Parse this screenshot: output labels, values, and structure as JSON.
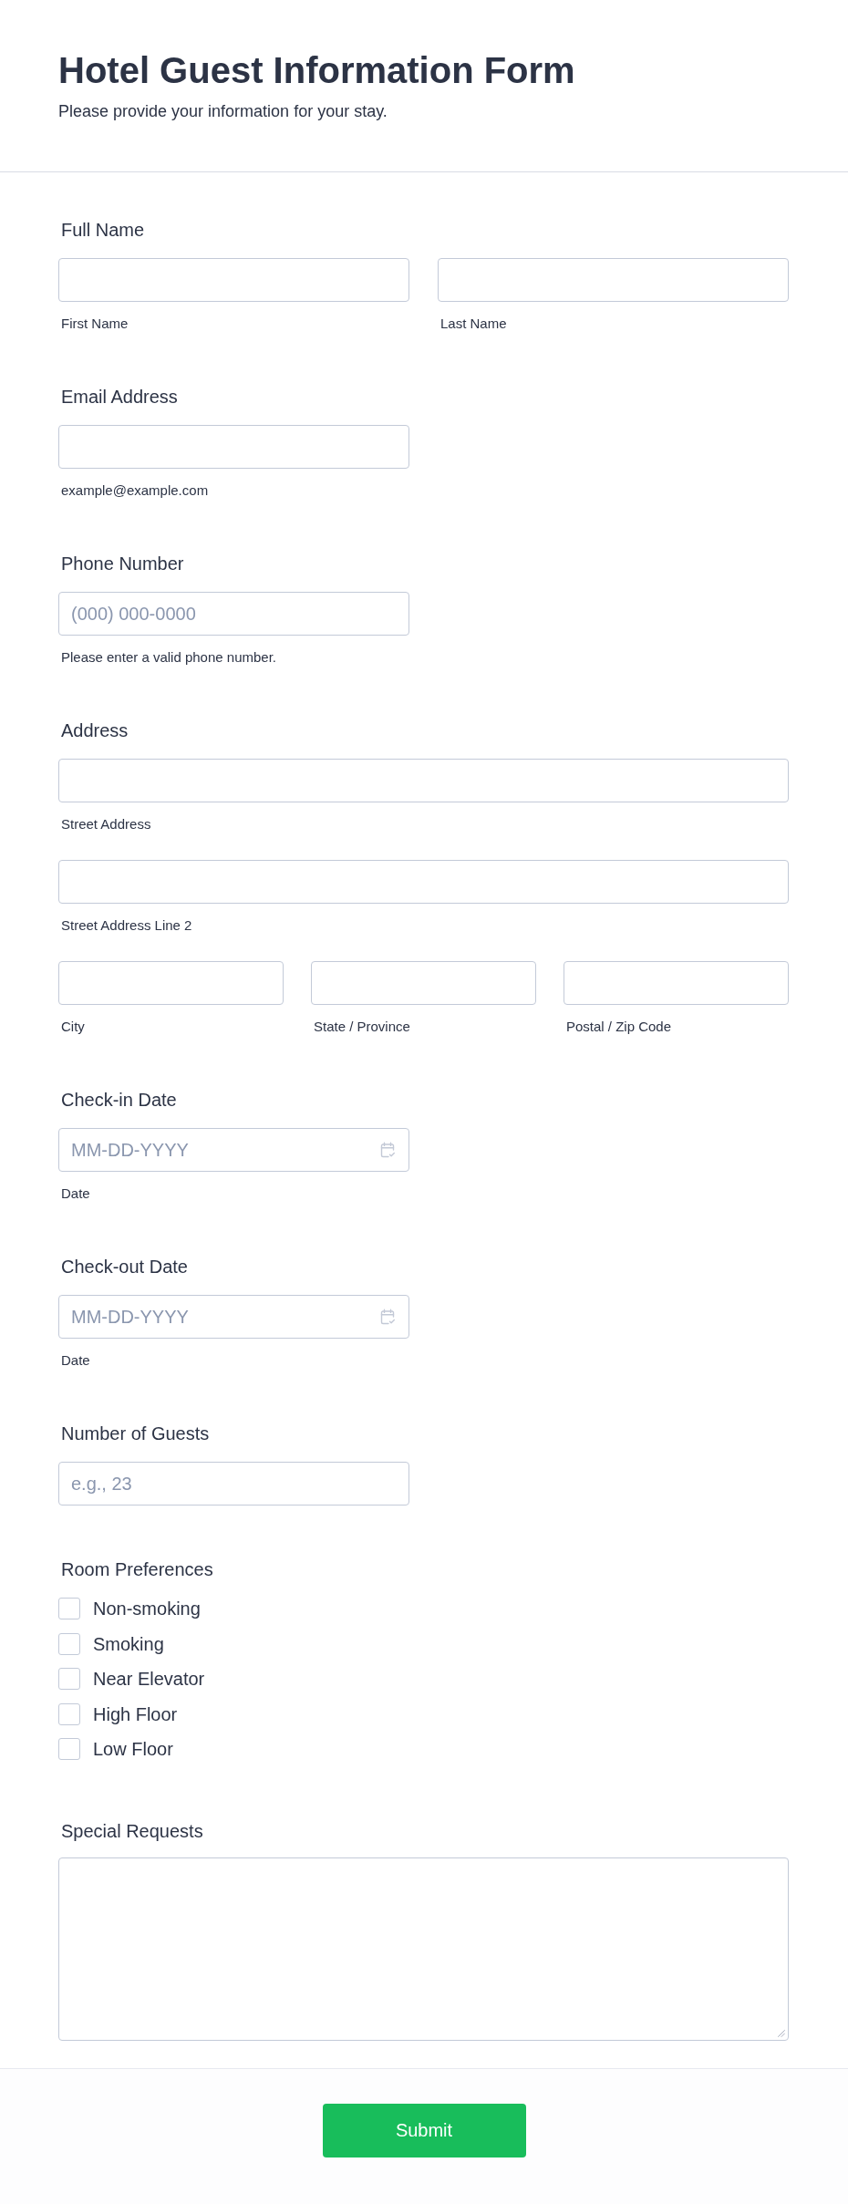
{
  "header": {
    "title": "Hotel Guest Information Form",
    "subtitle": "Please provide your information for your stay."
  },
  "fields": [
    {
      "kind": "text",
      "label": "Full Name",
      "rows": [
        {
          "inputs": [
            {
              "sublabel": "First Name"
            },
            {
              "sublabel": "Last Name"
            }
          ]
        }
      ]
    },
    {
      "kind": "text",
      "label": "Email Address",
      "rows": [
        {
          "inputs": [
            {
              "sublabel": "example@example.com"
            }
          ]
        }
      ]
    },
    {
      "kind": "text",
      "label": "Phone Number",
      "rows": [
        {
          "inputs": [
            {
              "placeholder": "(000) 000-0000",
              "sublabel": "Please enter a valid phone number."
            }
          ]
        }
      ]
    },
    {
      "kind": "address",
      "label": "Address",
      "rows": [
        {
          "inputs": [
            {
              "sublabel": "Street Address"
            }
          ]
        },
        {
          "inputs": [
            {
              "sublabel": "Street Address Line 2"
            }
          ]
        },
        {
          "inputs": [
            {
              "sublabel": "City"
            },
            {
              "sublabel": "State / Province"
            },
            {
              "sublabel": "Postal / Zip Code"
            }
          ]
        }
      ]
    },
    {
      "kind": "date",
      "label": "Check-in Date",
      "rows": [
        {
          "inputs": [
            {
              "placeholder": "MM-DD-YYYY",
              "sublabel": "Date"
            }
          ]
        }
      ]
    },
    {
      "kind": "date",
      "label": "Check-out Date",
      "rows": [
        {
          "inputs": [
            {
              "placeholder": "MM-DD-YYYY",
              "sublabel": "Date"
            }
          ]
        }
      ]
    },
    {
      "kind": "text",
      "label": "Number of Guests",
      "rows": [
        {
          "inputs": [
            {
              "placeholder": "e.g., 23"
            }
          ]
        }
      ]
    },
    {
      "kind": "checkboxes",
      "label": "Room Preferences",
      "options": [
        {
          "label": "Non-smoking",
          "checked": false
        },
        {
          "label": "Smoking",
          "checked": false
        },
        {
          "label": "Near Elevator",
          "checked": false
        },
        {
          "label": "High Floor",
          "checked": false
        },
        {
          "label": "Low Floor",
          "checked": false
        }
      ]
    },
    {
      "kind": "textarea",
      "label": "Special Requests"
    }
  ],
  "submit": {
    "label": "Submit"
  }
}
